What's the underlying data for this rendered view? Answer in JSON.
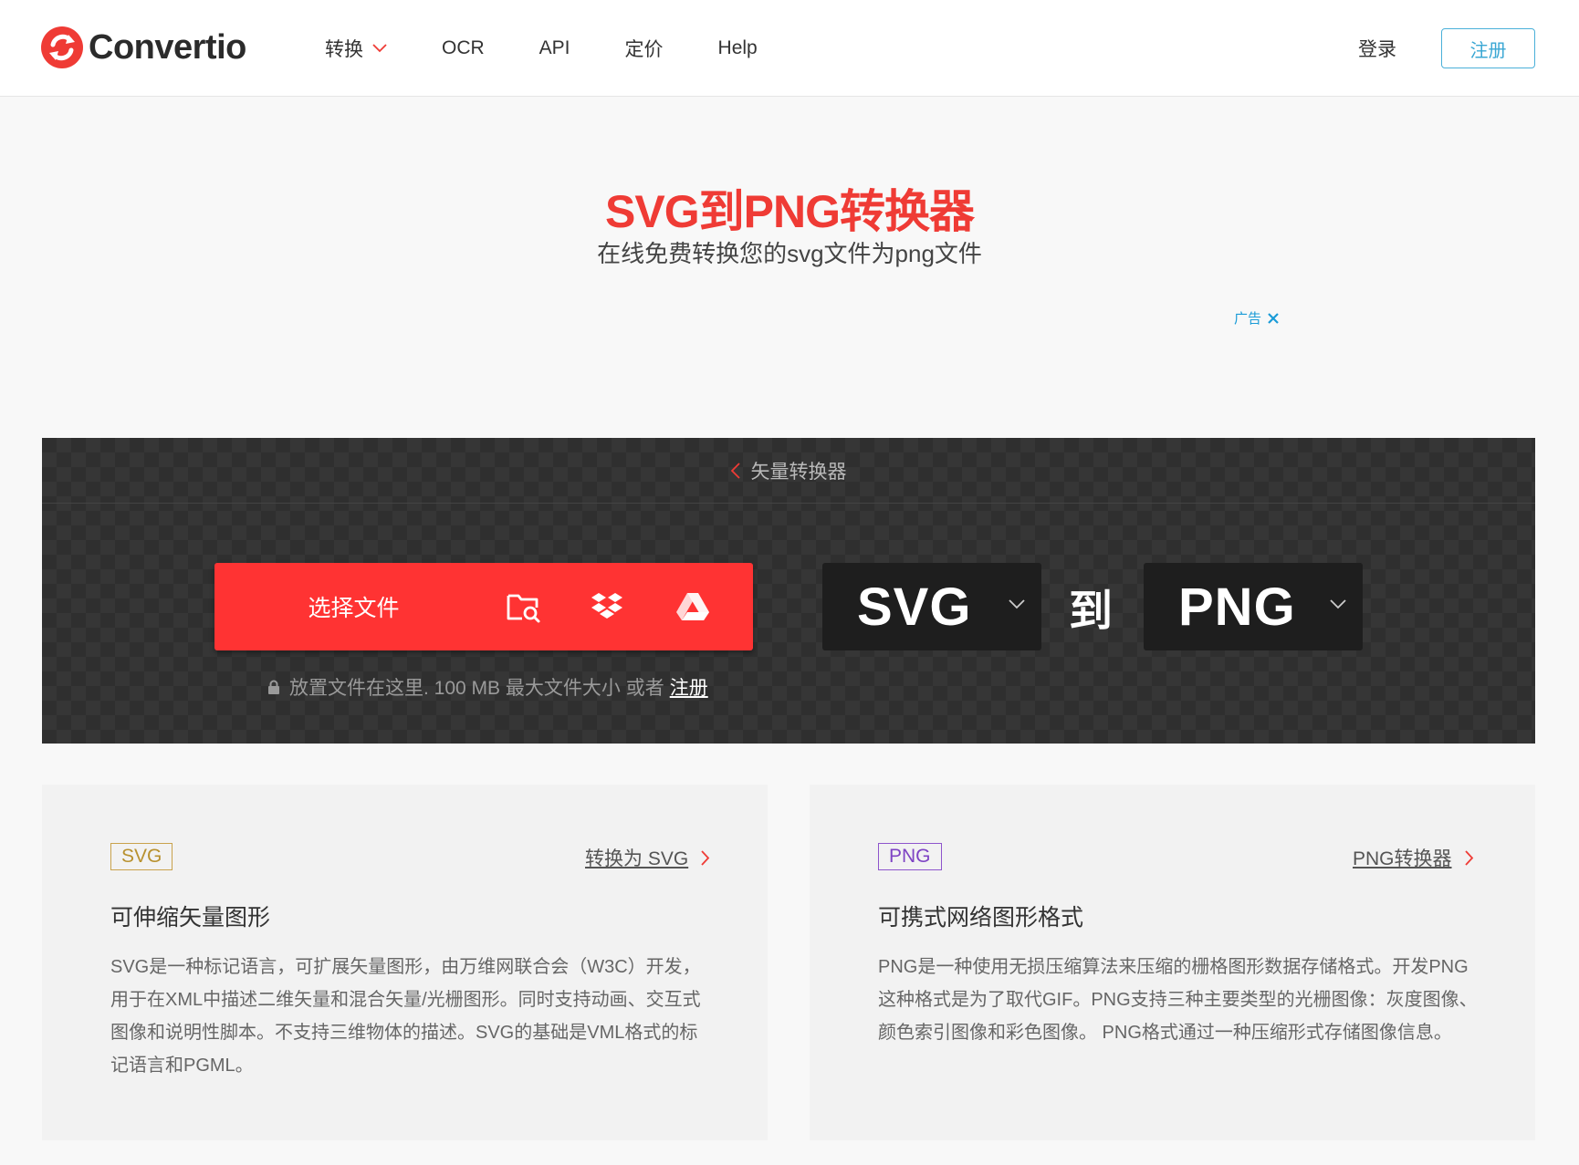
{
  "header": {
    "logo_text": "Convertio",
    "nav": [
      {
        "label": "转换",
        "has_dropdown": true
      },
      {
        "label": "OCR",
        "has_dropdown": false
      },
      {
        "label": "API",
        "has_dropdown": false
      },
      {
        "label": "定价",
        "has_dropdown": false
      },
      {
        "label": "Help",
        "has_dropdown": false
      }
    ],
    "login_label": "登录",
    "signup_label": "注册"
  },
  "hero": {
    "title": "SVG到PNG转换器",
    "subtitle": "在线免费转换您的svg文件为png文件",
    "ad_label": "广告"
  },
  "converter": {
    "category_link": "矢量转换器",
    "choose_label": "选择文件",
    "drop_note": "放置文件在这里. 100 MB 最大文件大小 或者",
    "drop_note_link": "注册",
    "from_format": "SVG",
    "to_word": "到",
    "to_format": "PNG",
    "icons": [
      "folder-search-icon",
      "dropbox-icon",
      "google-drive-icon"
    ]
  },
  "cards": [
    {
      "tag": "SVG",
      "link": "转换为 SVG",
      "title": "可伸缩矢量图形",
      "desc": "SVG是一种标记语言，可扩展矢量图形，由万维网联合会（W3C）开发，用于在XML中描述二维矢量和混合矢量/光栅图形。同时支持动画、交互式图像和说明性脚本。不支持三维物体的描述。SVG的基础是VML格式的标记语言和PGML。"
    },
    {
      "tag": "PNG",
      "link": "PNG转换器",
      "title": "可携式网络图形格式",
      "desc": "PNG是一种使用无损压缩算法来压缩的栅格图形数据存储格式。开发PNG这种格式是为了取代GIF。PNG支持三种主要类型的光栅图像：灰度图像、颜色索引图像和彩色图像。 PNG格式通过一种压缩形式存储图像信息。"
    }
  ],
  "colors": {
    "brand_red": "#ef3b35",
    "button_red": "#ff3333",
    "signup_blue": "#3aa7d4",
    "svg_tag": "#b8912f",
    "png_tag": "#7e43c4"
  }
}
